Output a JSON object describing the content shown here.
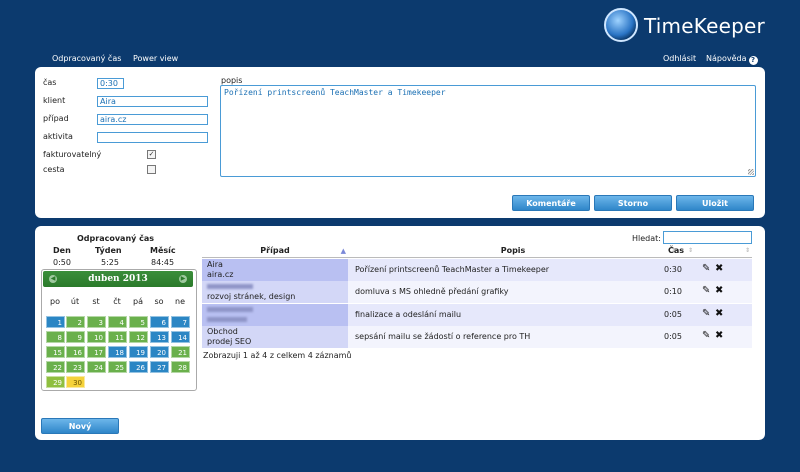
{
  "app": {
    "name": "TimeKeeper"
  },
  "nav": {
    "worked_time": "Odpracovaný čas",
    "power_view": "Power view",
    "logout": "Odhlásit",
    "help": "Nápověda"
  },
  "form": {
    "time_label": "čas",
    "time_value": "0:30",
    "client_label": "klient",
    "client_value": "Aira",
    "case_label": "případ",
    "case_value": "aira.cz",
    "activity_label": "aktivita",
    "activity_value": "",
    "billable_label": "fakturovatelný",
    "billable_checked": true,
    "trip_label": "cesta",
    "trip_checked": false,
    "desc_label": "popis",
    "desc_value": "Pořízení printscreenů TeachMaster a Timekeeper",
    "btn_comments": "Komentáře",
    "btn_cancel": "Storno",
    "btn_save": "Uložit"
  },
  "stats": {
    "title": "Odpracovaný čas",
    "day_label": "Den",
    "day_value": "0:50",
    "week_label": "Týden",
    "week_value": "5:25",
    "month_label": "Měsíc",
    "month_value": "84:45"
  },
  "calendar": {
    "title": "duben 2013",
    "weekdays": [
      "po",
      "út",
      "st",
      "čt",
      "pá",
      "so",
      "ne"
    ],
    "days": [
      "1",
      "2",
      "3",
      "4",
      "5",
      "6",
      "7",
      "8",
      "9",
      "10",
      "11",
      "12",
      "13",
      "14",
      "15",
      "16",
      "17",
      "18",
      "19",
      "20",
      "21",
      "22",
      "23",
      "24",
      "25",
      "26",
      "27",
      "28",
      "29",
      "30"
    ],
    "colors": {
      "green": "#6ab04c",
      "blue": "#2b86c4",
      "today": "#f5d23a"
    }
  },
  "new_button": "Nový",
  "table": {
    "search_label": "Hledat:",
    "search_value": "",
    "headers": {
      "case": "Případ",
      "description": "Popis",
      "time": "Čas"
    },
    "rows": [
      {
        "case_line1": "Aira",
        "case_line2": "aira.cz",
        "description": "Pořízení printscreenů TeachMaster a Timekeeper",
        "time": "0:30"
      },
      {
        "case_line1": "",
        "case_line2": "rozvoj stránek, design",
        "description": "domluva s MS ohledně předání grafiky",
        "time": "0:10"
      },
      {
        "case_line1": "",
        "case_line2": "",
        "description": "finalizace a odeslání mailu",
        "time": "0:05"
      },
      {
        "case_line1": "Obchod",
        "case_line2": "prodej SEO",
        "description": "sepsání mailu se žádostí o reference pro TH",
        "time": "0:05"
      }
    ],
    "footer": "Zobrazuji 1 až 4 z celkem 4 záznamů"
  }
}
